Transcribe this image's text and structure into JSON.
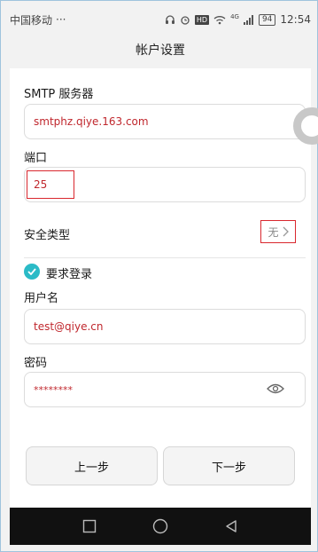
{
  "status_bar": {
    "carrier": "中国移动",
    "dots": "···",
    "battery": "94",
    "time": "12:54",
    "hd": "HD",
    "network": "4G"
  },
  "header": {
    "title": "帐户设置"
  },
  "form": {
    "smtp_label": "SMTP 服务器",
    "smtp_value": "smtphz.qiye.163.com",
    "port_label": "端口",
    "port_value": "25",
    "security_label": "安全类型",
    "security_value": "无",
    "login_required_label": "要求登录",
    "login_required_checked": true,
    "username_label": "用户名",
    "username_value": "test@qiye.cn",
    "password_label": "密码",
    "password_value": "********"
  },
  "buttons": {
    "prev": "上一步",
    "next": "下一步"
  },
  "colors": {
    "accent": "#2bbbc7",
    "value_text": "#c0272d",
    "highlight_box": "#d9272e"
  },
  "icons": {
    "nav": [
      "square-recent-icon",
      "circle-home-icon",
      "triangle-back-icon"
    ],
    "password": "eye-icon",
    "security": "chevron-right-icon",
    "check": "check-circle-icon"
  }
}
